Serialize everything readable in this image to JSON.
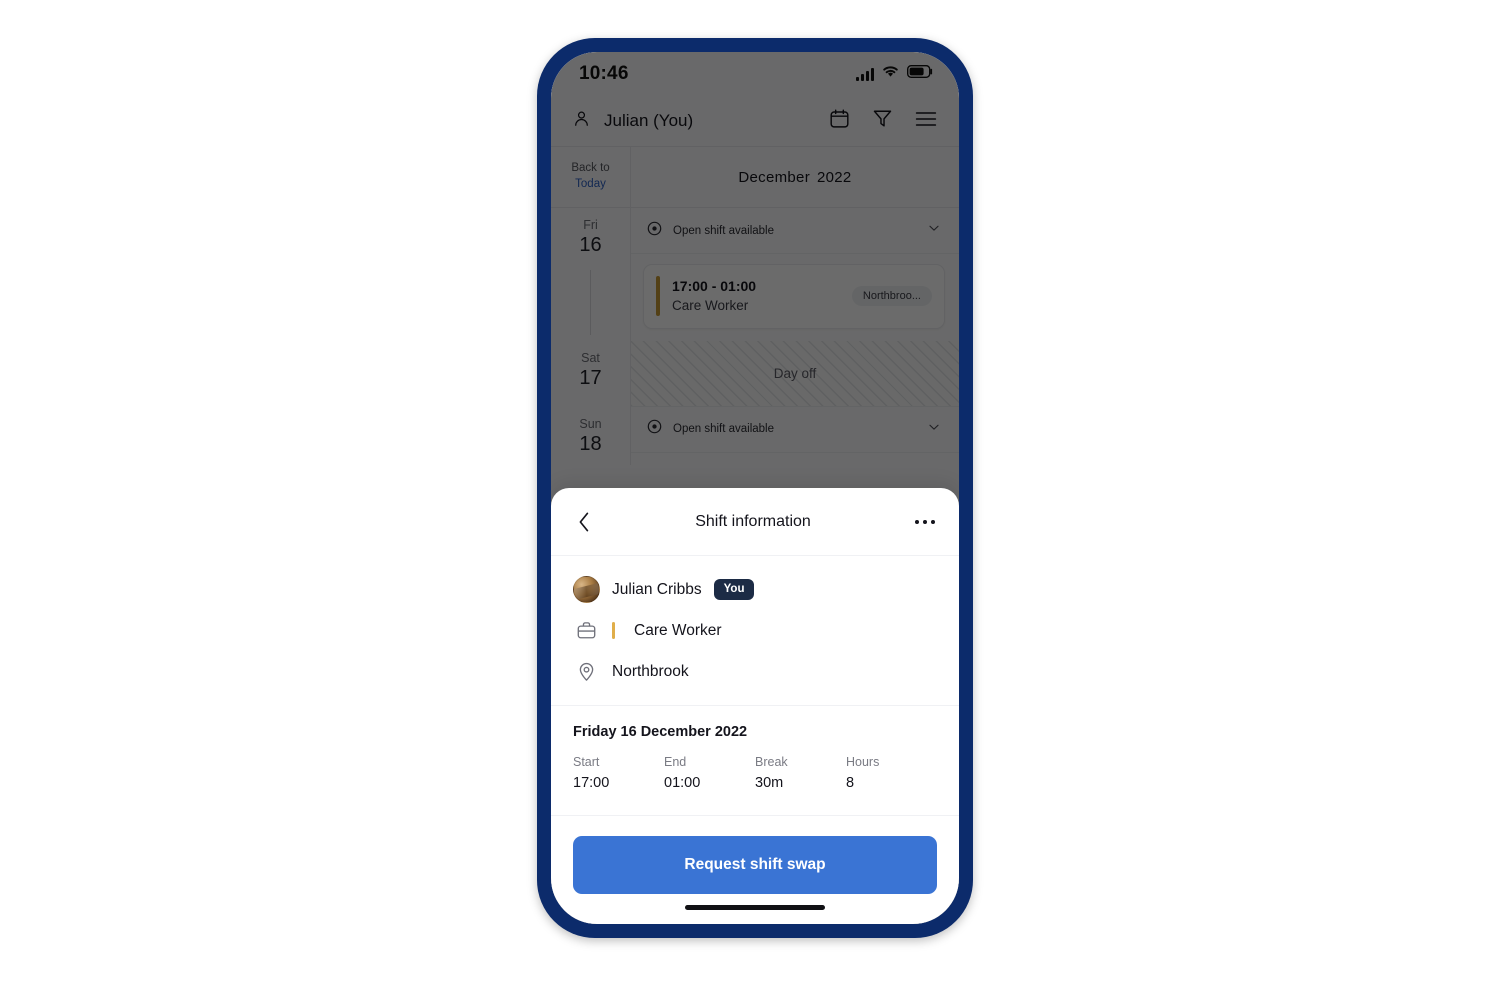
{
  "device": {
    "frame_color": "#0c2b6b",
    "screen_bg": "#fbfbfc"
  },
  "status_bar": {
    "time": "10:46",
    "icons": [
      "cellular-signal-icon",
      "wifi-icon",
      "battery-icon"
    ]
  },
  "app_header": {
    "user_label": "Julian (You)",
    "person_icon": "person-icon",
    "actions": [
      {
        "name": "calendar-icon",
        "label": "Calendar"
      },
      {
        "name": "filter-icon",
        "label": "Filter"
      },
      {
        "name": "hamburger-menu-icon",
        "label": "Menu"
      }
    ]
  },
  "month_bar": {
    "back_to_today_line1": "Back to",
    "back_to_today_line2": "Today",
    "month": "December",
    "year": "2022"
  },
  "schedule": {
    "rows": [
      {
        "dow": "Fri",
        "day": "16",
        "open_shift_label": "Open shift available",
        "shift": {
          "time": "17:00 - 01:00",
          "role": "Care Worker",
          "location_chip": "Northbroo...",
          "accent_color": "#c79a36"
        }
      },
      {
        "dow": "Sat",
        "day": "17",
        "day_off_label": "Day off"
      },
      {
        "dow": "Sun",
        "day": "18",
        "open_shift_label": "Open shift available"
      }
    ]
  },
  "sheet": {
    "title": "Shift information",
    "back_icon": "chevron-left-icon",
    "more_icon": "more-options-icon",
    "person": {
      "name": "Julian Cribbs",
      "badge": "You",
      "avatar": "user-avatar"
    },
    "role": {
      "icon": "briefcase-icon",
      "text": "Care Worker",
      "accent_color": "#e0ae4a"
    },
    "location": {
      "icon": "map-pin-icon",
      "text": "Northbrook"
    },
    "when": {
      "date": "Friday 16 December 2022",
      "fields": [
        {
          "key": "Start",
          "value": "17:00"
        },
        {
          "key": "End",
          "value": "01:00"
        },
        {
          "key": "Break",
          "value": "30m"
        },
        {
          "key": "Hours",
          "value": "8"
        }
      ]
    },
    "primary_action": {
      "label": "Request shift swap",
      "color": "#3a74d4"
    }
  }
}
